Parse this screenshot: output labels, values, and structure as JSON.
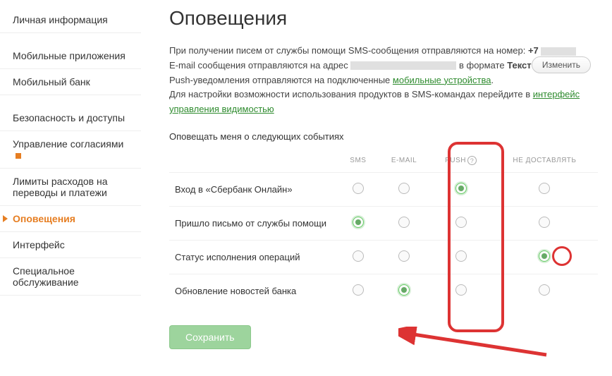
{
  "sidebar": {
    "items": [
      {
        "label": "Личная информация"
      },
      {
        "label": "Мобильные приложения"
      },
      {
        "label": "Мобильный банк"
      },
      {
        "label": "Безопасность и доступы"
      },
      {
        "label": "Управление согласиями"
      },
      {
        "label": "Лимиты расходов на переводы и платежи"
      },
      {
        "label": "Оповещения"
      },
      {
        "label": "Интерфейс"
      },
      {
        "label": "Специальное обслуживание"
      }
    ]
  },
  "page": {
    "title": "Оповещения"
  },
  "info": {
    "line1a": "При получении писем от службы помощи SMS-сообщения отправляются на номер: ",
    "phone_prefix": "+7",
    "line2a": "E-mail сообщения отправляются на адрес",
    "line2b": " в формате ",
    "format": "Текст",
    "change": "Изменить",
    "line3a": "Push-уведомления отправляются на подключенные ",
    "link_devices": "мобильные устройства",
    "line4a": "Для настройки возможности использования продуктов в SMS-командах перейдите в ",
    "link_visibility": "интерфейс управления видимостью"
  },
  "subtitle": "Оповещать меня о следующих событиях",
  "columns": {
    "event": "",
    "sms": "SMS",
    "email": "E-MAIL",
    "push": "PUSH",
    "none": "НЕ ДОСТАВЛЯТЬ"
  },
  "rows": [
    {
      "label": "Вход в «Сбербанк Онлайн»",
      "selected": "push"
    },
    {
      "label": "Пришло письмо от службы помощи",
      "selected": "sms"
    },
    {
      "label": "Статус исполнения операций",
      "selected": "none"
    },
    {
      "label": "Обновление новостей банка",
      "selected": "email"
    }
  ],
  "save": "Сохранить"
}
